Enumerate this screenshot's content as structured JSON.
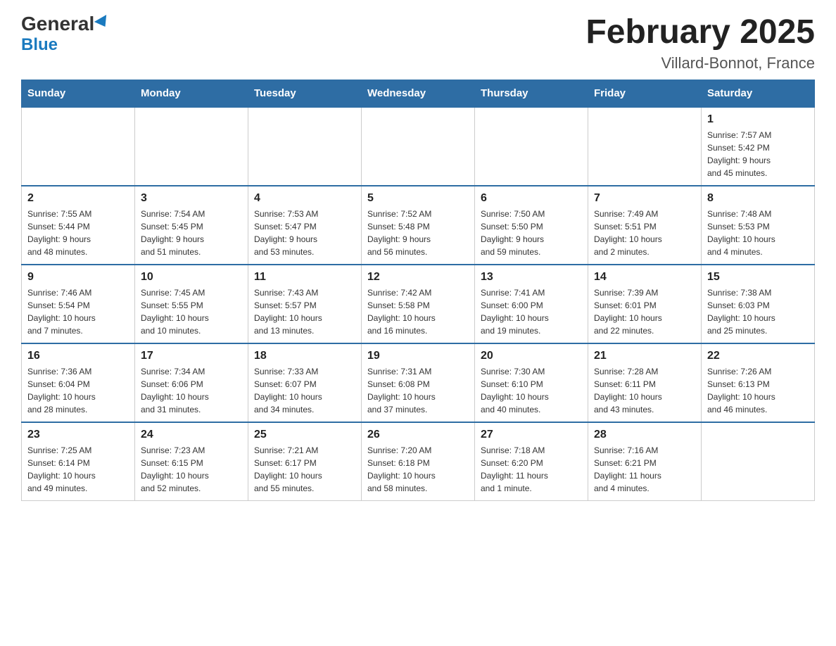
{
  "header": {
    "logo_general": "General",
    "logo_blue": "Blue",
    "month_title": "February 2025",
    "location": "Villard-Bonnot, France"
  },
  "days_of_week": [
    "Sunday",
    "Monday",
    "Tuesday",
    "Wednesday",
    "Thursday",
    "Friday",
    "Saturday"
  ],
  "weeks": [
    {
      "days": [
        {
          "num": "",
          "info": ""
        },
        {
          "num": "",
          "info": ""
        },
        {
          "num": "",
          "info": ""
        },
        {
          "num": "",
          "info": ""
        },
        {
          "num": "",
          "info": ""
        },
        {
          "num": "",
          "info": ""
        },
        {
          "num": "1",
          "info": "Sunrise: 7:57 AM\nSunset: 5:42 PM\nDaylight: 9 hours\nand 45 minutes."
        }
      ]
    },
    {
      "days": [
        {
          "num": "2",
          "info": "Sunrise: 7:55 AM\nSunset: 5:44 PM\nDaylight: 9 hours\nand 48 minutes."
        },
        {
          "num": "3",
          "info": "Sunrise: 7:54 AM\nSunset: 5:45 PM\nDaylight: 9 hours\nand 51 minutes."
        },
        {
          "num": "4",
          "info": "Sunrise: 7:53 AM\nSunset: 5:47 PM\nDaylight: 9 hours\nand 53 minutes."
        },
        {
          "num": "5",
          "info": "Sunrise: 7:52 AM\nSunset: 5:48 PM\nDaylight: 9 hours\nand 56 minutes."
        },
        {
          "num": "6",
          "info": "Sunrise: 7:50 AM\nSunset: 5:50 PM\nDaylight: 9 hours\nand 59 minutes."
        },
        {
          "num": "7",
          "info": "Sunrise: 7:49 AM\nSunset: 5:51 PM\nDaylight: 10 hours\nand 2 minutes."
        },
        {
          "num": "8",
          "info": "Sunrise: 7:48 AM\nSunset: 5:53 PM\nDaylight: 10 hours\nand 4 minutes."
        }
      ]
    },
    {
      "days": [
        {
          "num": "9",
          "info": "Sunrise: 7:46 AM\nSunset: 5:54 PM\nDaylight: 10 hours\nand 7 minutes."
        },
        {
          "num": "10",
          "info": "Sunrise: 7:45 AM\nSunset: 5:55 PM\nDaylight: 10 hours\nand 10 minutes."
        },
        {
          "num": "11",
          "info": "Sunrise: 7:43 AM\nSunset: 5:57 PM\nDaylight: 10 hours\nand 13 minutes."
        },
        {
          "num": "12",
          "info": "Sunrise: 7:42 AM\nSunset: 5:58 PM\nDaylight: 10 hours\nand 16 minutes."
        },
        {
          "num": "13",
          "info": "Sunrise: 7:41 AM\nSunset: 6:00 PM\nDaylight: 10 hours\nand 19 minutes."
        },
        {
          "num": "14",
          "info": "Sunrise: 7:39 AM\nSunset: 6:01 PM\nDaylight: 10 hours\nand 22 minutes."
        },
        {
          "num": "15",
          "info": "Sunrise: 7:38 AM\nSunset: 6:03 PM\nDaylight: 10 hours\nand 25 minutes."
        }
      ]
    },
    {
      "days": [
        {
          "num": "16",
          "info": "Sunrise: 7:36 AM\nSunset: 6:04 PM\nDaylight: 10 hours\nand 28 minutes."
        },
        {
          "num": "17",
          "info": "Sunrise: 7:34 AM\nSunset: 6:06 PM\nDaylight: 10 hours\nand 31 minutes."
        },
        {
          "num": "18",
          "info": "Sunrise: 7:33 AM\nSunset: 6:07 PM\nDaylight: 10 hours\nand 34 minutes."
        },
        {
          "num": "19",
          "info": "Sunrise: 7:31 AM\nSunset: 6:08 PM\nDaylight: 10 hours\nand 37 minutes."
        },
        {
          "num": "20",
          "info": "Sunrise: 7:30 AM\nSunset: 6:10 PM\nDaylight: 10 hours\nand 40 minutes."
        },
        {
          "num": "21",
          "info": "Sunrise: 7:28 AM\nSunset: 6:11 PM\nDaylight: 10 hours\nand 43 minutes."
        },
        {
          "num": "22",
          "info": "Sunrise: 7:26 AM\nSunset: 6:13 PM\nDaylight: 10 hours\nand 46 minutes."
        }
      ]
    },
    {
      "days": [
        {
          "num": "23",
          "info": "Sunrise: 7:25 AM\nSunset: 6:14 PM\nDaylight: 10 hours\nand 49 minutes."
        },
        {
          "num": "24",
          "info": "Sunrise: 7:23 AM\nSunset: 6:15 PM\nDaylight: 10 hours\nand 52 minutes."
        },
        {
          "num": "25",
          "info": "Sunrise: 7:21 AM\nSunset: 6:17 PM\nDaylight: 10 hours\nand 55 minutes."
        },
        {
          "num": "26",
          "info": "Sunrise: 7:20 AM\nSunset: 6:18 PM\nDaylight: 10 hours\nand 58 minutes."
        },
        {
          "num": "27",
          "info": "Sunrise: 7:18 AM\nSunset: 6:20 PM\nDaylight: 11 hours\nand 1 minute."
        },
        {
          "num": "28",
          "info": "Sunrise: 7:16 AM\nSunset: 6:21 PM\nDaylight: 11 hours\nand 4 minutes."
        },
        {
          "num": "",
          "info": ""
        }
      ]
    }
  ]
}
